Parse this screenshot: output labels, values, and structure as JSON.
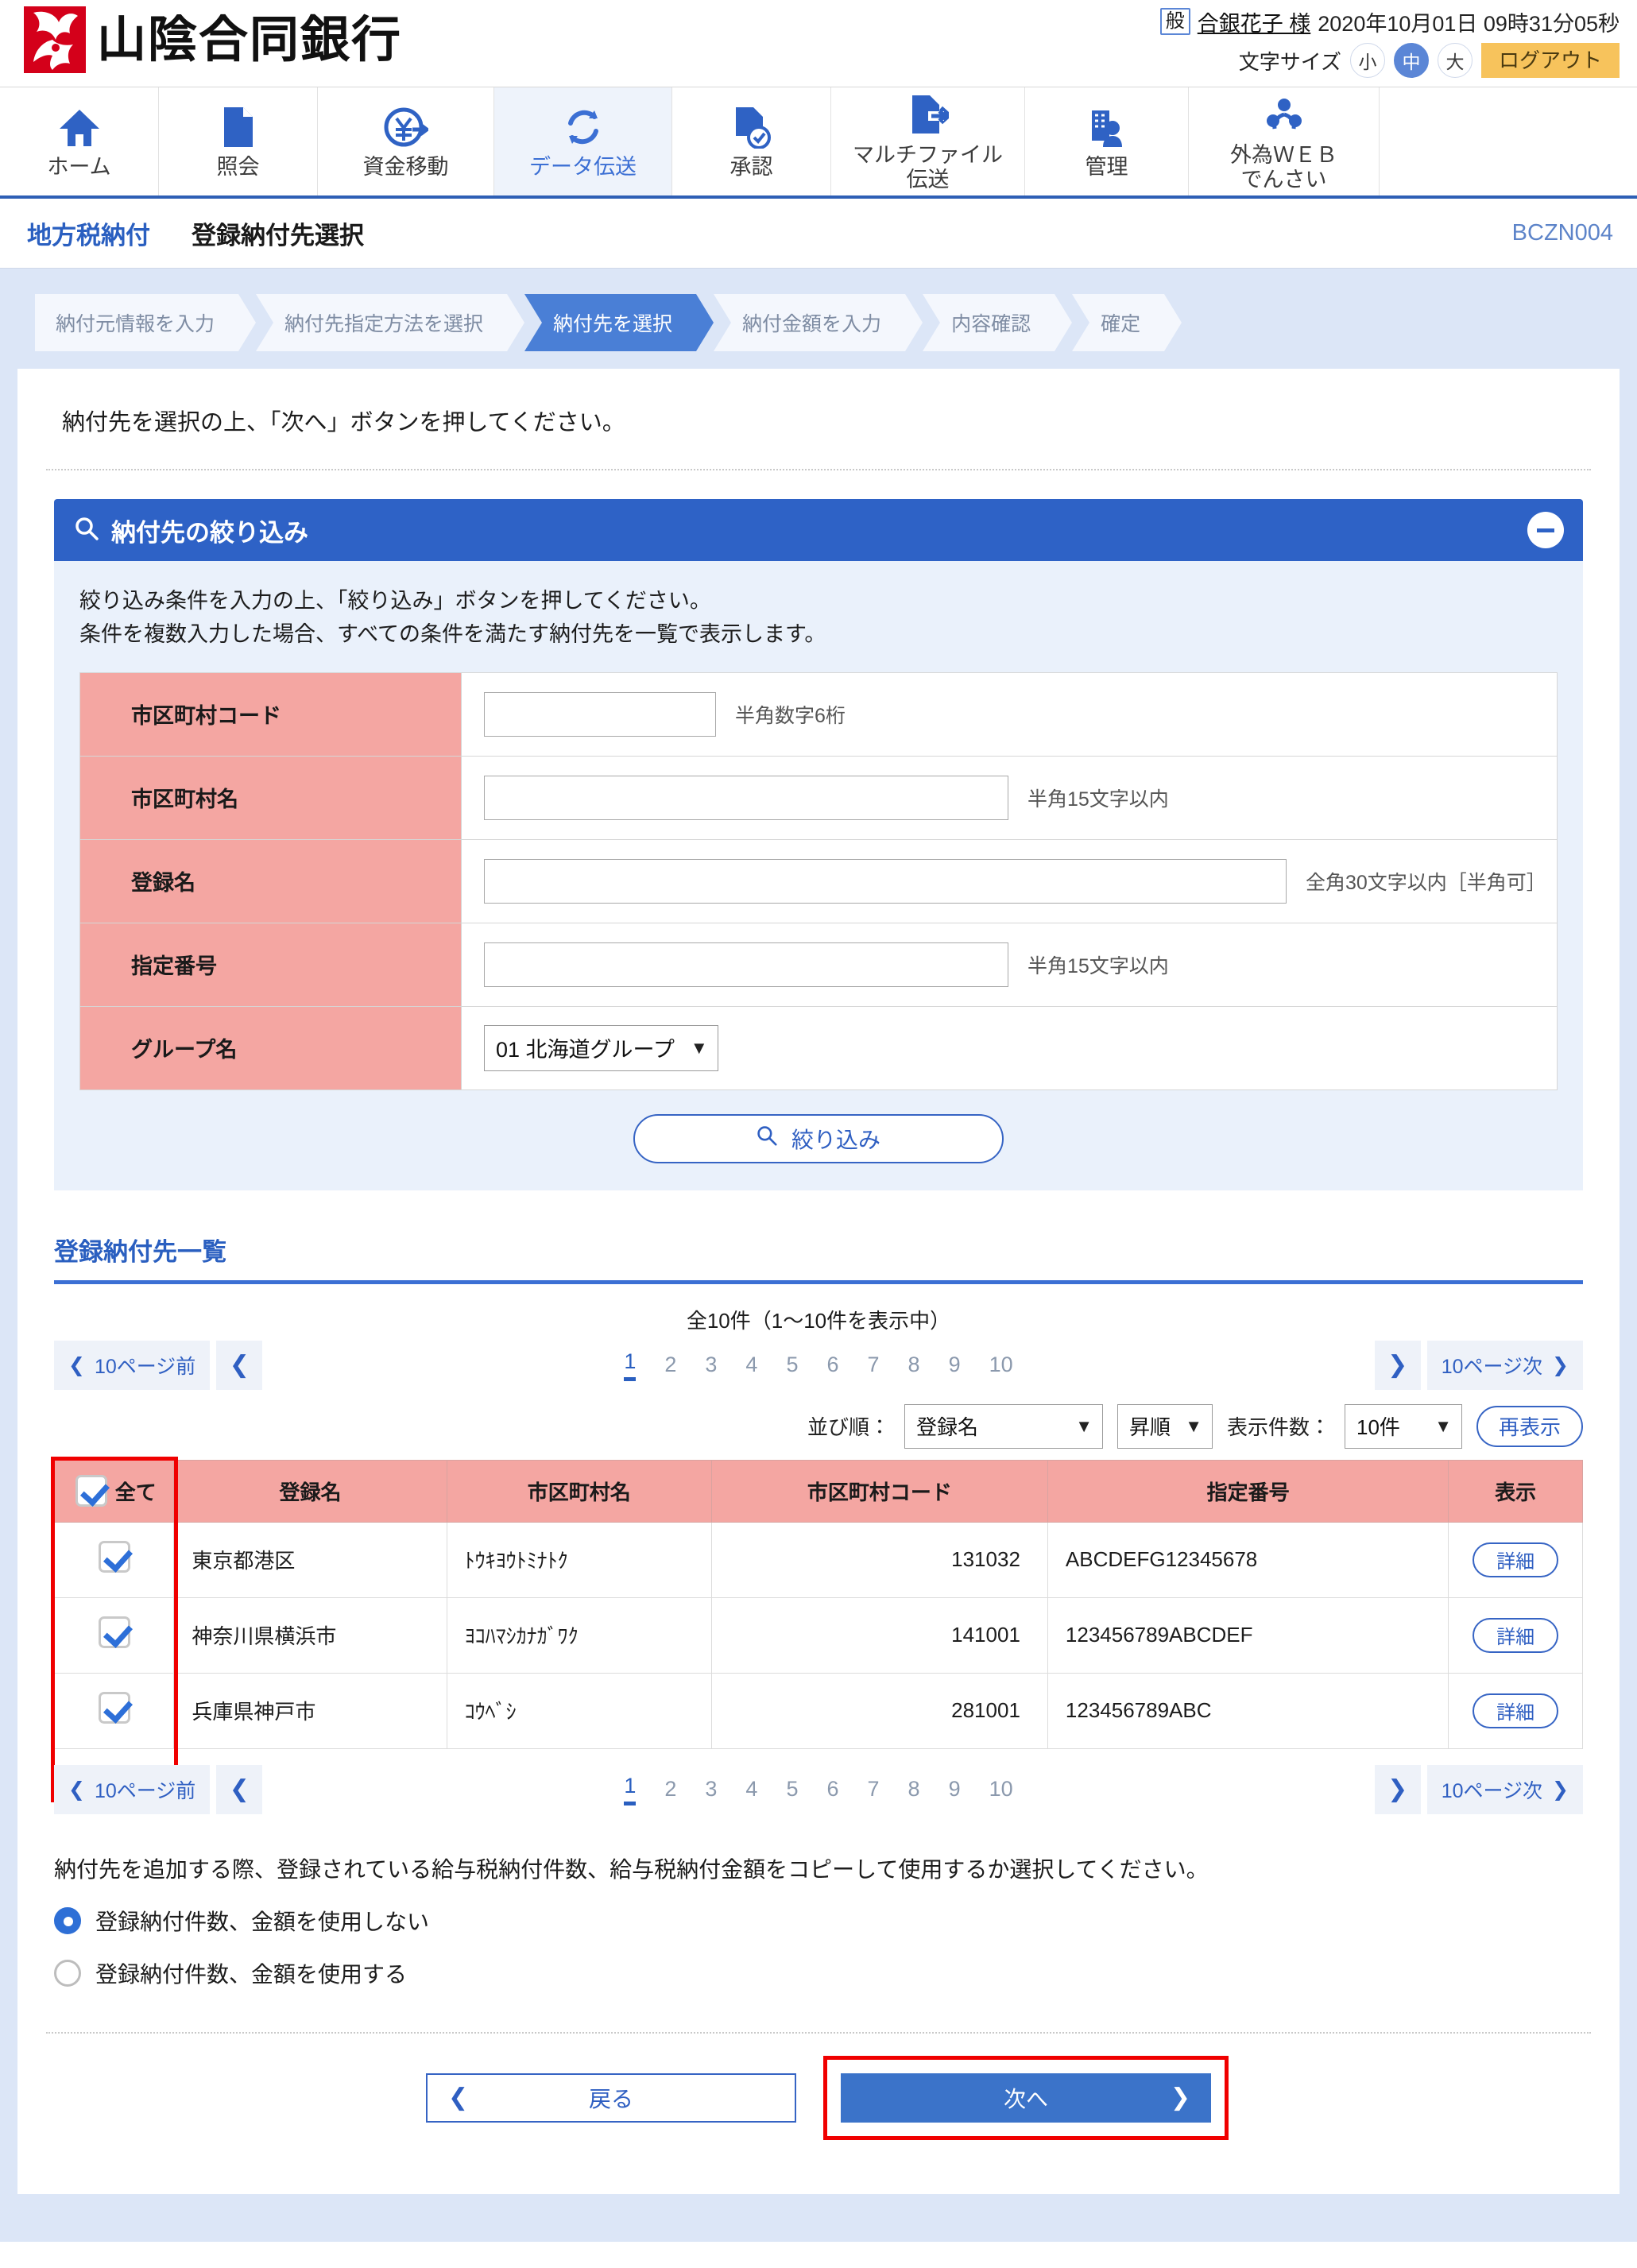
{
  "header": {
    "bank_name": "山陰合同銀行",
    "user_badge": "般",
    "user_name": "合銀花子 様",
    "datetime": "2020年10月01日 09時31分05秒",
    "font_size_label": "文字サイズ",
    "font_size_options": [
      "小",
      "中",
      "大"
    ],
    "font_size_selected": "中",
    "logout_label": "ログアウト"
  },
  "nav": {
    "items": [
      {
        "label": "ホーム",
        "icon": "home-icon",
        "active": false
      },
      {
        "label": "照会",
        "icon": "document-icon",
        "active": false
      },
      {
        "label": "資金移動",
        "icon": "yen-transfer-icon",
        "active": false
      },
      {
        "label": "データ伝送",
        "icon": "sync-icon",
        "active": true
      },
      {
        "label": "承認",
        "icon": "approve-icon",
        "active": false
      },
      {
        "label": "マルチファイル\n伝送",
        "icon": "multifile-icon",
        "active": false
      },
      {
        "label": "管理",
        "icon": "manage-icon",
        "active": false
      },
      {
        "label": "外為ＷＥＢ\nでんさい",
        "icon": "forex-icon",
        "active": false
      }
    ]
  },
  "page": {
    "category": "地方税納付",
    "title": "登録納付先選択",
    "code": "BCZN004"
  },
  "steps": [
    {
      "label": "納付元情報を入力",
      "current": false
    },
    {
      "label": "納付先指定方法を選択",
      "current": false
    },
    {
      "label": "納付先を選択",
      "current": true
    },
    {
      "label": "納付金額を入力",
      "current": false
    },
    {
      "label": "内容確認",
      "current": false
    },
    {
      "label": "確定",
      "current": false
    }
  ],
  "instruction": "納付先を選択の上、「次へ」ボタンを押してください。",
  "filter": {
    "title": "納付先の絞り込み",
    "search_icon": "search-icon",
    "collapse_icon": "minus-icon",
    "desc_line1": "絞り込み条件を入力の上、「絞り込み」ボタンを押してください。",
    "desc_line2": "条件を複数入力した場合、すべての条件を満たす納付先を一覧で表示します。",
    "rows": [
      {
        "label": "市区町村コード",
        "type": "text",
        "value": "",
        "hint": "半角数字6桁",
        "width": "code"
      },
      {
        "label": "市区町村名",
        "type": "text",
        "value": "",
        "hint": "半角15文字以内",
        "width": "name"
      },
      {
        "label": "登録名",
        "type": "text",
        "value": "",
        "hint": "全角30文字以内［半角可］",
        "width": "reg"
      },
      {
        "label": "指定番号",
        "type": "text",
        "value": "",
        "hint": "半角15文字以内",
        "width": "num"
      },
      {
        "label": "グループ名",
        "type": "select",
        "value": "01 北海道グループ",
        "hint": "",
        "width": ""
      }
    ],
    "button_label": "絞り込み"
  },
  "list": {
    "section_title": "登録納付先一覧",
    "count_text": "全10件（1～10件を表示中）",
    "pager": {
      "prev10_label": "10ページ前",
      "next10_label": "10ページ次",
      "prev_icon": "chevron-left-icon",
      "next_icon": "chevron-right-icon",
      "pages": [
        "1",
        "2",
        "3",
        "4",
        "5",
        "6",
        "7",
        "8",
        "9",
        "10"
      ],
      "current_page": "1"
    },
    "controls": {
      "sort_label": "並び順：",
      "sort_value": "登録名",
      "order_value": "昇順",
      "per_page_label": "表示件数：",
      "per_page_value": "10件",
      "refresh_label": "再表示"
    },
    "columns": {
      "select_all": "全て",
      "reg_name": "登録名",
      "city_name": "市区町村名",
      "city_code": "市区町村コード",
      "designation": "指定番号",
      "display": "表示"
    },
    "detail_label": "詳細",
    "rows": [
      {
        "checked": true,
        "reg_name": "東京都港区",
        "city_kana": "ﾄｳｷﾖｳﾄﾐﾅﾄｸ",
        "city_code": "131032",
        "designation": "ABCDEFG12345678"
      },
      {
        "checked": true,
        "reg_name": "神奈川県横浜市",
        "city_kana": "ﾖｺﾊﾏｼｶﾅｶﾞﾜｸ",
        "city_code": "141001",
        "designation": "123456789ABCDEF"
      },
      {
        "checked": true,
        "reg_name": "兵庫県神戸市",
        "city_kana": "ｺｳﾍﾞｼ",
        "city_code": "281001",
        "designation": "123456789ABC"
      }
    ],
    "all_checked": true
  },
  "copy_option": {
    "desc": "納付先を追加する際、登録されている給与税納付件数、給与税納付金額をコピーして使用するか選択してください。",
    "options": [
      {
        "label": "登録納付件数、金額を使用しない",
        "selected": true
      },
      {
        "label": "登録納付件数、金額を使用する",
        "selected": false
      }
    ]
  },
  "actions": {
    "back_label": "戻る",
    "next_label": "次へ",
    "back_icon": "chevron-left-icon",
    "next_icon": "chevron-right-icon"
  },
  "colors": {
    "brand_blue": "#2e62c6",
    "nav_active_bg": "#eef3fb",
    "label_pink": "#f4a6a2",
    "logo_red": "#d4001a",
    "logout_yellow": "#f7c35c",
    "highlight_red": "#f00000"
  }
}
